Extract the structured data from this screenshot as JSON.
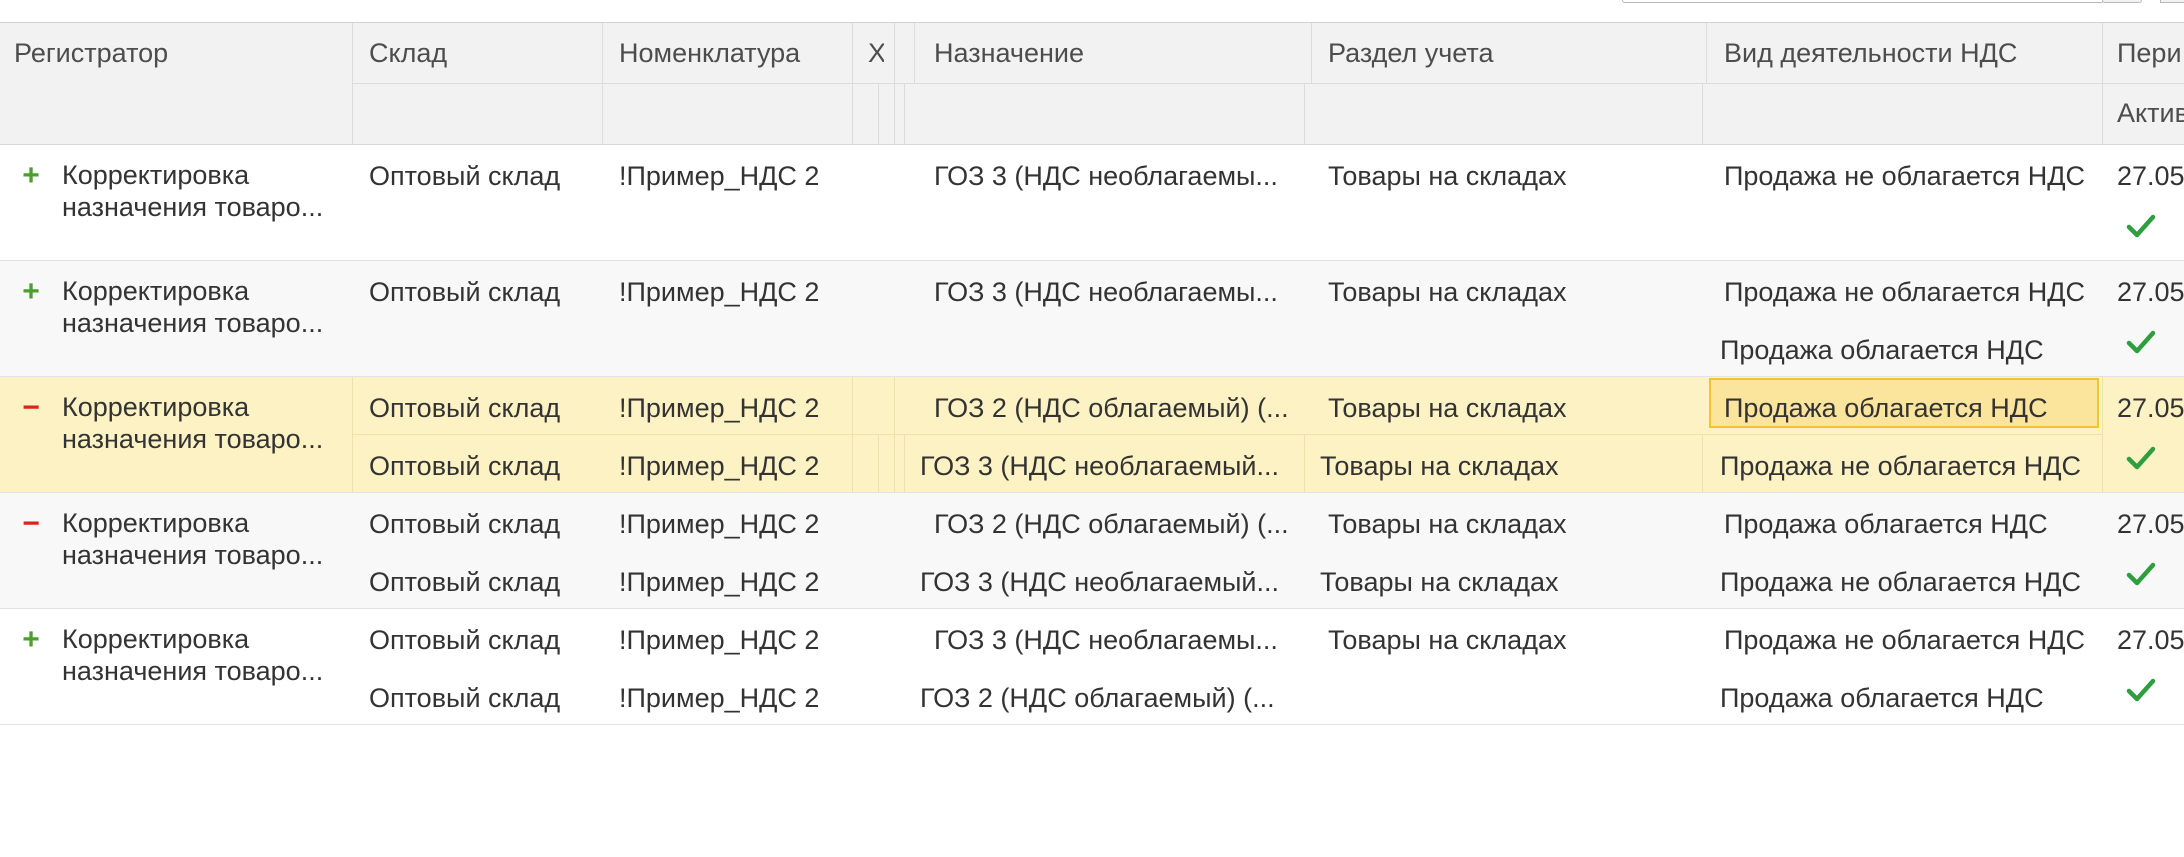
{
  "header": {
    "col_registrator": "Регистратор",
    "col_warehouse": "Склад",
    "col_nomenclature": "Номенклатура",
    "col_char": "Х",
    "col_purpose": "Назначение",
    "col_account_section": "Раздел учета",
    "col_vat_activity": "Вид деятельности НДС",
    "col_period": "Пери",
    "col_active": "Активн"
  },
  "rows": [
    {
      "sign": "+",
      "registrator_line1": "Корректировка",
      "registrator_line2": "назначения товаро...",
      "warehouse": "Оптовый склад",
      "nomenclature": "!Пример_НДС 2",
      "purpose": "ГОЗ 3 (НДС необлагаемы...",
      "account_section": "Товары на складах",
      "vat_activity": "Продажа не облагается НДС",
      "vat_activity_2": "",
      "period": "27.05",
      "active": "✓"
    },
    {
      "sign": "+",
      "registrator_line1": "Корректировка",
      "registrator_line2": "назначения товаро...",
      "warehouse": "Оптовый склад",
      "nomenclature": "!Пример_НДС 2",
      "purpose": "ГОЗ 3 (НДС необлагаемы...",
      "account_section": "Товары на складах",
      "vat_activity": "Продажа не облагается НДС",
      "vat_activity_2": "Продажа облагается НДС",
      "period": "27.05",
      "active": "✓"
    },
    {
      "sign": "−",
      "registrator_line1": "Корректировка",
      "registrator_line2": "назначения товаро...",
      "warehouse": "Оптовый склад",
      "nomenclature": "!Пример_НДС 2",
      "purpose": "ГОЗ 2 (НДС облагаемый) (...",
      "account_section": "Товары на складах",
      "vat_activity": "Продажа облагается НДС",
      "warehouse_2": "Оптовый склад",
      "nomenclature_2": "!Пример_НДС 2",
      "purpose_2": "ГОЗ 3 (НДС необлагаемый...",
      "account_section_2": "Товары на складах",
      "vat_activity_2": "Продажа не облагается НДС",
      "period": "27.05",
      "active": "✓"
    },
    {
      "sign": "−",
      "registrator_line1": "Корректировка",
      "registrator_line2": "назначения товаро...",
      "warehouse": "Оптовый склад",
      "nomenclature": "!Пример_НДС 2",
      "purpose": "ГОЗ 2 (НДС облагаемый) (...",
      "account_section": "Товары на складах",
      "vat_activity": "Продажа облагается НДС",
      "warehouse_2": "Оптовый склад",
      "nomenclature_2": "!Пример_НДС 2",
      "purpose_2": "ГОЗ 3 (НДС необлагаемый...",
      "account_section_2": "Товары на складах",
      "vat_activity_2": "Продажа не облагается НДС",
      "period": "27.05",
      "active": "✓"
    },
    {
      "sign": "+",
      "registrator_line1": "Корректировка",
      "registrator_line2": "назначения товаро...",
      "warehouse": "Оптовый склад",
      "nomenclature": "!Пример_НДС 2",
      "purpose": "ГОЗ 3 (НДС необлагаемы...",
      "account_section": "Товары на складах",
      "vat_activity": "Продажа не облагается НДС",
      "warehouse_2": "Оптовый склад",
      "nomenclature_2": "!Пример_НДС 2",
      "purpose_2": "ГОЗ 2 (НДС облагаемый) (...",
      "account_section_2": "",
      "vat_activity_2": "Продажа облагается НДС",
      "period": "27.05",
      "active": "✓"
    }
  ],
  "colors": {
    "plus": "#4aa02c",
    "minus": "#d9261c",
    "selected_row": "#fdf2c4",
    "focus_cell": "#fbe49b",
    "focus_border": "#f2c430",
    "check": "#2e9e3e"
  }
}
